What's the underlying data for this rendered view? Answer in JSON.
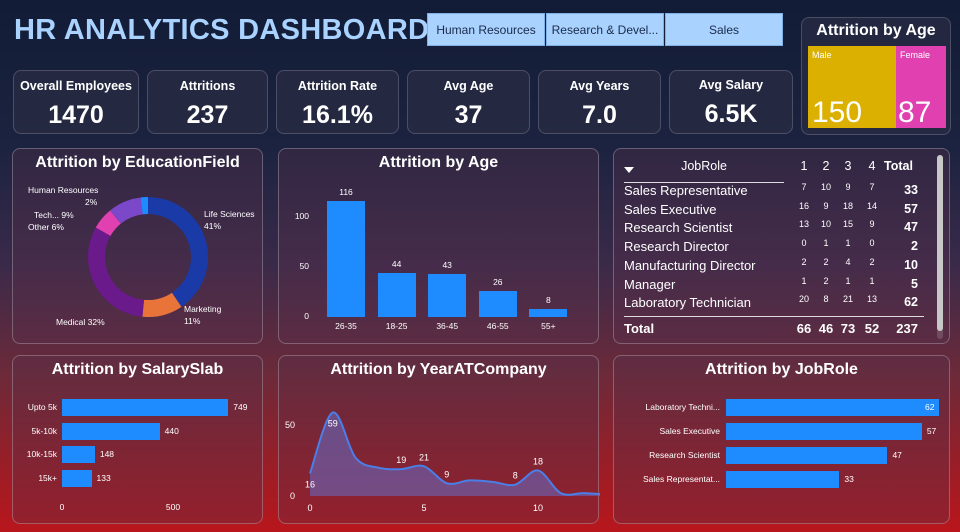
{
  "title": "HR ANALYTICS DASHBOARD",
  "slicers": [
    "Human Resources",
    "Research & Devel...",
    "Sales"
  ],
  "kpis": [
    {
      "label": "Overall Employees",
      "value": "1470"
    },
    {
      "label": "Attritions",
      "value": "237"
    },
    {
      "label": "Attrition Rate",
      "value": "16.1%"
    },
    {
      "label": "Avg Age",
      "value": "37"
    },
    {
      "label": "Avg Years",
      "value": "7.0"
    },
    {
      "label": "Avg Salary",
      "value": "6.5K"
    }
  ],
  "gender": {
    "title": "Attrition by Age",
    "male_label": "Male",
    "male_value": "150",
    "male_color": "#dcb000",
    "female_label": "Female",
    "female_value": "87",
    "female_color": "#e040b0"
  },
  "panels": {
    "education": "Attrition by EducationField",
    "age": "Attrition by Age",
    "salary": "Attrition by SalarySlab",
    "years": "Attrition by YearATCompany",
    "jobrole": "Attrition by JobRole"
  },
  "edu_labels": {
    "hr": "Human Resources",
    "hr_pct": "2%",
    "tech": "Tech... 9%",
    "other": "Other 6%",
    "life": "Life Sciences",
    "life_pct": "41%",
    "marketing": "Marketing",
    "marketing_pct": "11%",
    "medical": "Medical 32%"
  },
  "table": {
    "header": [
      "JobRole",
      "1",
      "2",
      "3",
      "4",
      "Total"
    ],
    "rows": [
      [
        "Sales Representative",
        "7",
        "10",
        "9",
        "7",
        "33"
      ],
      [
        "Sales Executive",
        "16",
        "9",
        "18",
        "14",
        "57"
      ],
      [
        "Research Scientist",
        "13",
        "10",
        "15",
        "9",
        "47"
      ],
      [
        "Research Director",
        "0",
        "1",
        "1",
        "0",
        "2"
      ],
      [
        "Manufacturing Director",
        "2",
        "2",
        "4",
        "2",
        "10"
      ],
      [
        "Manager",
        "1",
        "2",
        "1",
        "1",
        "5"
      ],
      [
        "Laboratory Technician",
        "20",
        "8",
        "21",
        "13",
        "62"
      ]
    ],
    "total": [
      "Total",
      "66",
      "46",
      "73",
      "52",
      "237"
    ]
  },
  "chart_data": [
    {
      "type": "pie",
      "title": "Attrition by EducationField",
      "categories": [
        "Life Sciences",
        "Marketing",
        "Medical",
        "Other",
        "Technical Degree",
        "Human Resources"
      ],
      "values": [
        41,
        11,
        32,
        6,
        9,
        2
      ],
      "colors": [
        "#1a3aa8",
        "#e8743a",
        "#6a1a8a",
        "#e040b0",
        "#7a48c8",
        "#1e8cff"
      ]
    },
    {
      "type": "bar",
      "title": "Attrition by Age",
      "categories": [
        "26-35",
        "18-25",
        "36-45",
        "46-55",
        "55+"
      ],
      "values": [
        116,
        44,
        43,
        26,
        8
      ],
      "yticks": [
        "0",
        "50",
        "100"
      ],
      "ylim": [
        0,
        125
      ]
    },
    {
      "type": "bar",
      "orientation": "horizontal",
      "title": "Attrition by SalarySlab",
      "categories": [
        "Upto 5k",
        "5k-10k",
        "10k-15k",
        "15k+"
      ],
      "values": [
        749,
        440,
        148,
        133
      ],
      "xticks": [
        "0",
        "500"
      ],
      "xlim": [
        0,
        1000
      ]
    },
    {
      "type": "area",
      "title": "Attrition by YearATCompany",
      "x": [
        0,
        1,
        2,
        3,
        4,
        5,
        6,
        7,
        8,
        9,
        10,
        11,
        12,
        13
      ],
      "values": [
        16,
        59,
        27,
        20,
        19,
        21,
        9,
        11,
        10,
        8,
        18,
        2,
        2,
        1
      ],
      "labels_shown": {
        "0": "16",
        "1": "59",
        "4": "19",
        "5": "21",
        "6": "9",
        "9": "8",
        "10": "18"
      },
      "xticks": [
        "0",
        "5",
        "10"
      ],
      "yticks": [
        "0",
        "50"
      ],
      "ylim": [
        0,
        65
      ]
    },
    {
      "type": "bar",
      "orientation": "horizontal",
      "title": "Attrition by JobRole",
      "categories": [
        "Laboratory Techni...",
        "Sales Executive",
        "Research Scientist",
        "Sales Representat..."
      ],
      "values": [
        62,
        57,
        47,
        33
      ],
      "xlim": [
        0,
        62
      ]
    }
  ]
}
